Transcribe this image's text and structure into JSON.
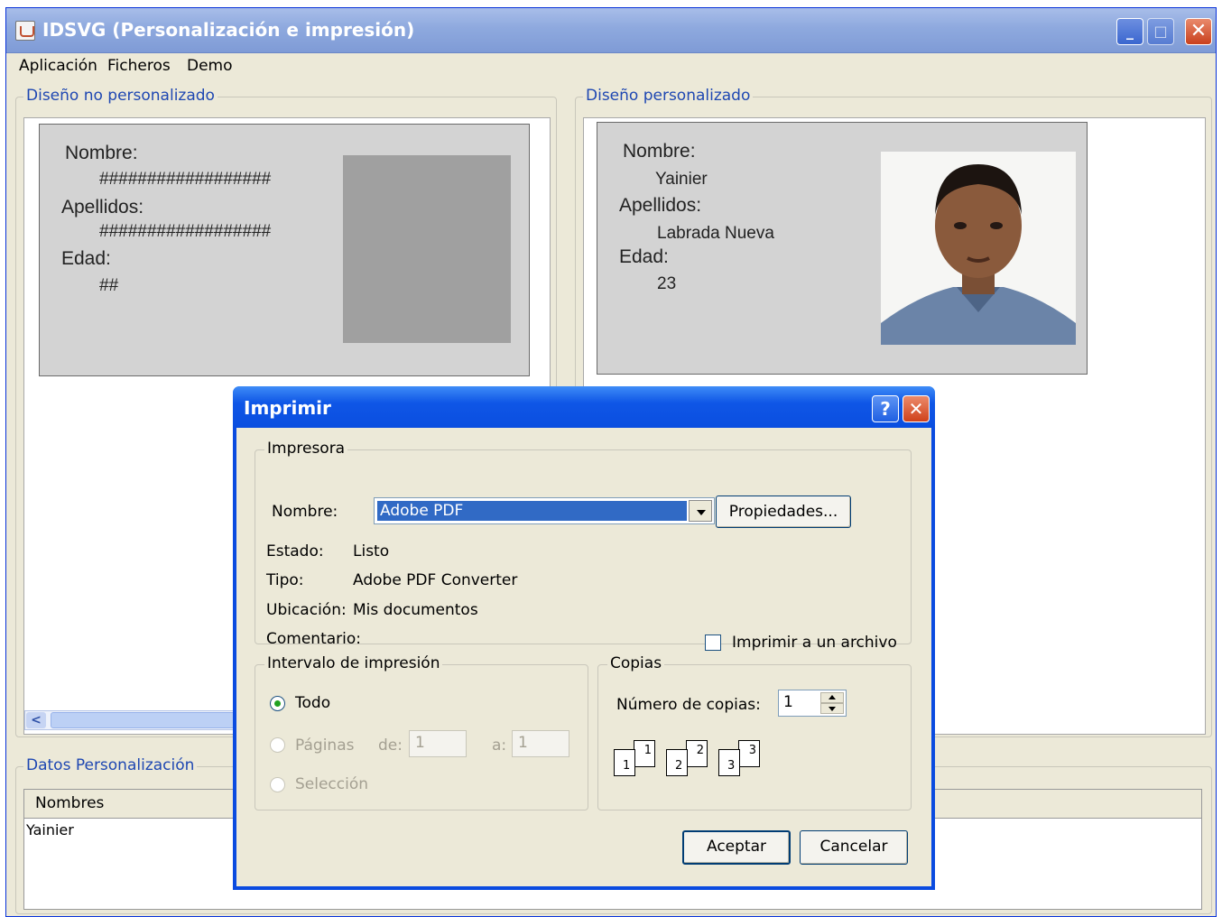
{
  "window": {
    "title": "IDSVG (Personalización e impresión)"
  },
  "menu": [
    "Aplicación",
    "Ficheros",
    "Demo"
  ],
  "left_group": {
    "label": "Diseño no personalizado",
    "card": {
      "nombre_label": "Nombre:",
      "nombre_value": "##################",
      "apellidos_label": "Apellidos:",
      "apellidos_value": "##################",
      "edad_label": "Edad:",
      "edad_value": "##"
    }
  },
  "right_group": {
    "label": "Diseño personalizado",
    "card": {
      "nombre_label": "Nombre:",
      "nombre_value": "Yainier",
      "apellidos_label": "Apellidos:",
      "apellidos_value": "Labrada Nueva",
      "edad_label": "Edad:",
      "edad_value": "23"
    }
  },
  "datos": {
    "label": "Datos Personalización",
    "columns": [
      "Nombres"
    ],
    "rows": [
      [
        "Yainier"
      ]
    ]
  },
  "print_dialog": {
    "title": "Imprimir",
    "help": "?",
    "printer_group": "Impresora",
    "name_label": "Nombre:",
    "printer_name": "Adobe PDF",
    "properties_button": "Propiedades...",
    "estado_label": "Estado:",
    "estado_value": "Listo",
    "tipo_label": "Tipo:",
    "tipo_value": "Adobe PDF Converter",
    "ubicacion_label": "Ubicación:",
    "ubicacion_value": "Mis documentos",
    "comentario_label": "Comentario:",
    "print_to_file": "Imprimir a un archivo",
    "range_group": "Intervalo de impresión",
    "range_all": "Todo",
    "range_pages": "Páginas",
    "from_label": "de:",
    "from_value": "1",
    "to_label": "a:",
    "to_value": "1",
    "range_selection": "Selección",
    "copies_group": "Copias",
    "copies_label": "Número de copias:",
    "copies_value": "1",
    "collate_pages": [
      "1",
      "2",
      "3"
    ],
    "ok_button": "Aceptar",
    "cancel_button": "Cancelar"
  }
}
